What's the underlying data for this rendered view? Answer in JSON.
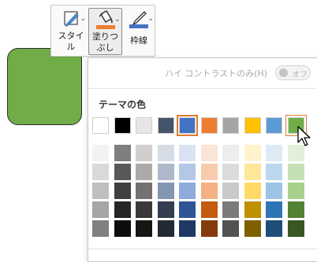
{
  "ribbon": {
    "style_label": "スタイ\nル",
    "fill_label": "塗りつ\nぶし",
    "border_label": "枠線",
    "fill_color": "#ed7d31",
    "border_color": "#4472c4"
  },
  "shape": {
    "fill": "#70ad47"
  },
  "panel": {
    "high_contrast_label": "ハイ コントラストのみ(H)",
    "toggle_text": "オフ",
    "theme_colors_title": "テーマの色",
    "theme_colors": [
      "#ffffff",
      "#000000",
      "#e7e6e6",
      "#44546a",
      "#4472c4",
      "#ed7d31",
      "#a5a5a5",
      "#ffc000",
      "#5b9bd5",
      "#70ad47"
    ],
    "tints": [
      [
        "#f2f2f2",
        "#d9d9d9",
        "#bfbfbf",
        "#a6a6a6",
        "#808080"
      ],
      [
        "#7f7f7f",
        "#595959",
        "#404040",
        "#262626",
        "#0d0d0d"
      ],
      [
        "#d0cece",
        "#aeaaaa",
        "#757171",
        "#3a3838",
        "#171616"
      ],
      [
        "#d6dce5",
        "#adb9ca",
        "#8497b0",
        "#333f50",
        "#222a35"
      ],
      [
        "#dae3f3",
        "#b4c7e7",
        "#8faadc",
        "#2f5597",
        "#203864"
      ],
      [
        "#fbe5d6",
        "#f8cbad",
        "#f4b183",
        "#c55a11",
        "#843c0c"
      ],
      [
        "#ededed",
        "#dbdbdb",
        "#c9c9c9",
        "#7b7b7b",
        "#525252"
      ],
      [
        "#fff2cc",
        "#ffe699",
        "#ffd966",
        "#bf9000",
        "#7f6000"
      ],
      [
        "#deebf7",
        "#bdd7ee",
        "#9dc3e6",
        "#2e75b6",
        "#1f4e79"
      ],
      [
        "#e2f0d9",
        "#c5e0b4",
        "#a9d18e",
        "#548235",
        "#385723"
      ]
    ],
    "selected_index": 4,
    "hover_index": 9
  }
}
